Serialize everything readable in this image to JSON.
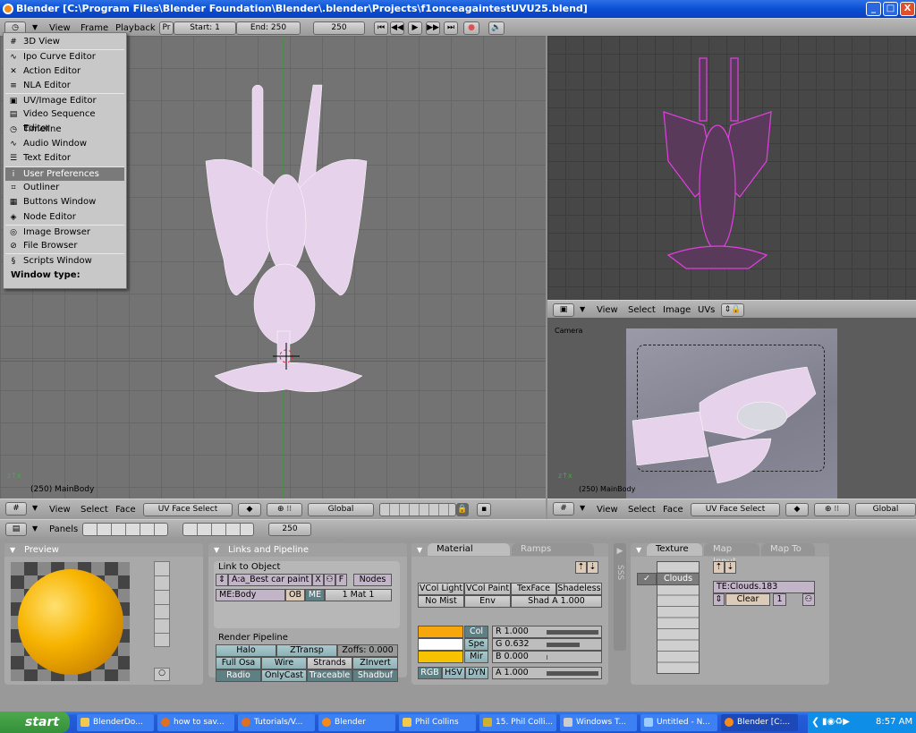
{
  "window": {
    "title": "Blender [C:\\Program Files\\Blender Foundation\\Blender\\.blender\\Projects\\f1onceagaintestUVU25.blend]",
    "buttons": [
      "_",
      "□",
      "X"
    ]
  },
  "timeline_header": {
    "menus": [
      "View",
      "Frame",
      "Playback"
    ],
    "pr": "Pr",
    "start": "Start: 1",
    "end": "End: 250",
    "current": "250"
  },
  "window_type_menu": {
    "items": [
      "3D View",
      "Ipo Curve Editor",
      "Action Editor",
      "NLA Editor",
      "UV/Image Editor",
      "Video Sequence Editor",
      "Timeline",
      "Audio Window",
      "Text Editor",
      "User Preferences",
      "Outliner",
      "Buttons Window",
      "Node Editor",
      "Image Browser",
      "File Browser",
      "Scripts Window"
    ],
    "selected": "User Preferences",
    "title": "Window type:"
  },
  "viewport_left": {
    "status": "(250) MainBody",
    "header": {
      "menus": [
        "View",
        "Select",
        "Face"
      ],
      "mode": "UV Face Select",
      "orientation": "Global"
    }
  },
  "uv_editor": {
    "header": {
      "menus": [
        "View",
        "Select",
        "Image",
        "UVs"
      ]
    }
  },
  "viewport_camera": {
    "label": "Camera",
    "status": "(250) MainBody",
    "header": {
      "menus": [
        "View",
        "Select",
        "Face"
      ],
      "mode": "UV Face Select",
      "orientation": "Global"
    }
  },
  "buttons_header": {
    "panels_label": "Panels",
    "frame": "250"
  },
  "preview_panel": {
    "title": "Preview"
  },
  "links_panel": {
    "title": "Links and Pipeline",
    "link_to_object": "Link to Object",
    "material_name": "A:a_Best car  paint",
    "x": "X",
    "f": "F",
    "nodes": "Nodes",
    "mesh": "ME:Body",
    "ob": "OB",
    "me": "ME",
    "mat": "1 Mat 1",
    "render_pipeline": "Render Pipeline",
    "pipeline_buttons": [
      "Halo",
      "ZTransp",
      "Zoffs: 0.000",
      "Full Osa",
      "Wire",
      "Strands",
      "ZInvert",
      "Radio",
      "OnlyCast",
      "Traceable",
      "Shadbuf"
    ]
  },
  "material_panel": {
    "tabs": [
      "Material",
      "Ramps"
    ],
    "row1": [
      "VCol Light",
      "VCol Paint",
      "TexFace",
      "Shadeless"
    ],
    "no_mist": "No Mist",
    "env": "Env",
    "shad_a": "Shad A 1.000",
    "color_buttons": [
      "Col",
      "Spe",
      "Mir"
    ],
    "swatches": [
      "#f7a70c",
      "#ffffff",
      "#f7c300"
    ],
    "r": "R 1.000",
    "g": "G 0.632",
    "b": "B 0.000",
    "a": "A 1.000",
    "rgb_values": [
      1.0,
      0.632,
      0.0,
      1.0
    ],
    "modes": [
      "RGB",
      "HSV",
      "DYN"
    ],
    "sss": "SSS"
  },
  "texture_panel": {
    "tabs": [
      "Texture",
      "Map Input",
      "Map To"
    ],
    "slot": "Clouds",
    "texture_name": "TE:Clouds.183",
    "clear": "Clear",
    "users": "1"
  },
  "taskbar": {
    "start": "start",
    "tasks": [
      "BlenderDo...",
      "how to sav...",
      "Tutorials/V...",
      "Blender",
      "Phil Collins",
      "15. Phil Colli...",
      "Windows T...",
      "Untitled - N...",
      "Blender [C:..."
    ],
    "time": "8:57 AM"
  },
  "colors": {
    "xp_blue": "#245edb",
    "blender_gray": "#a9a9a9",
    "mesh": "#e8d4ec",
    "uv_pink": "#e040e0"
  }
}
